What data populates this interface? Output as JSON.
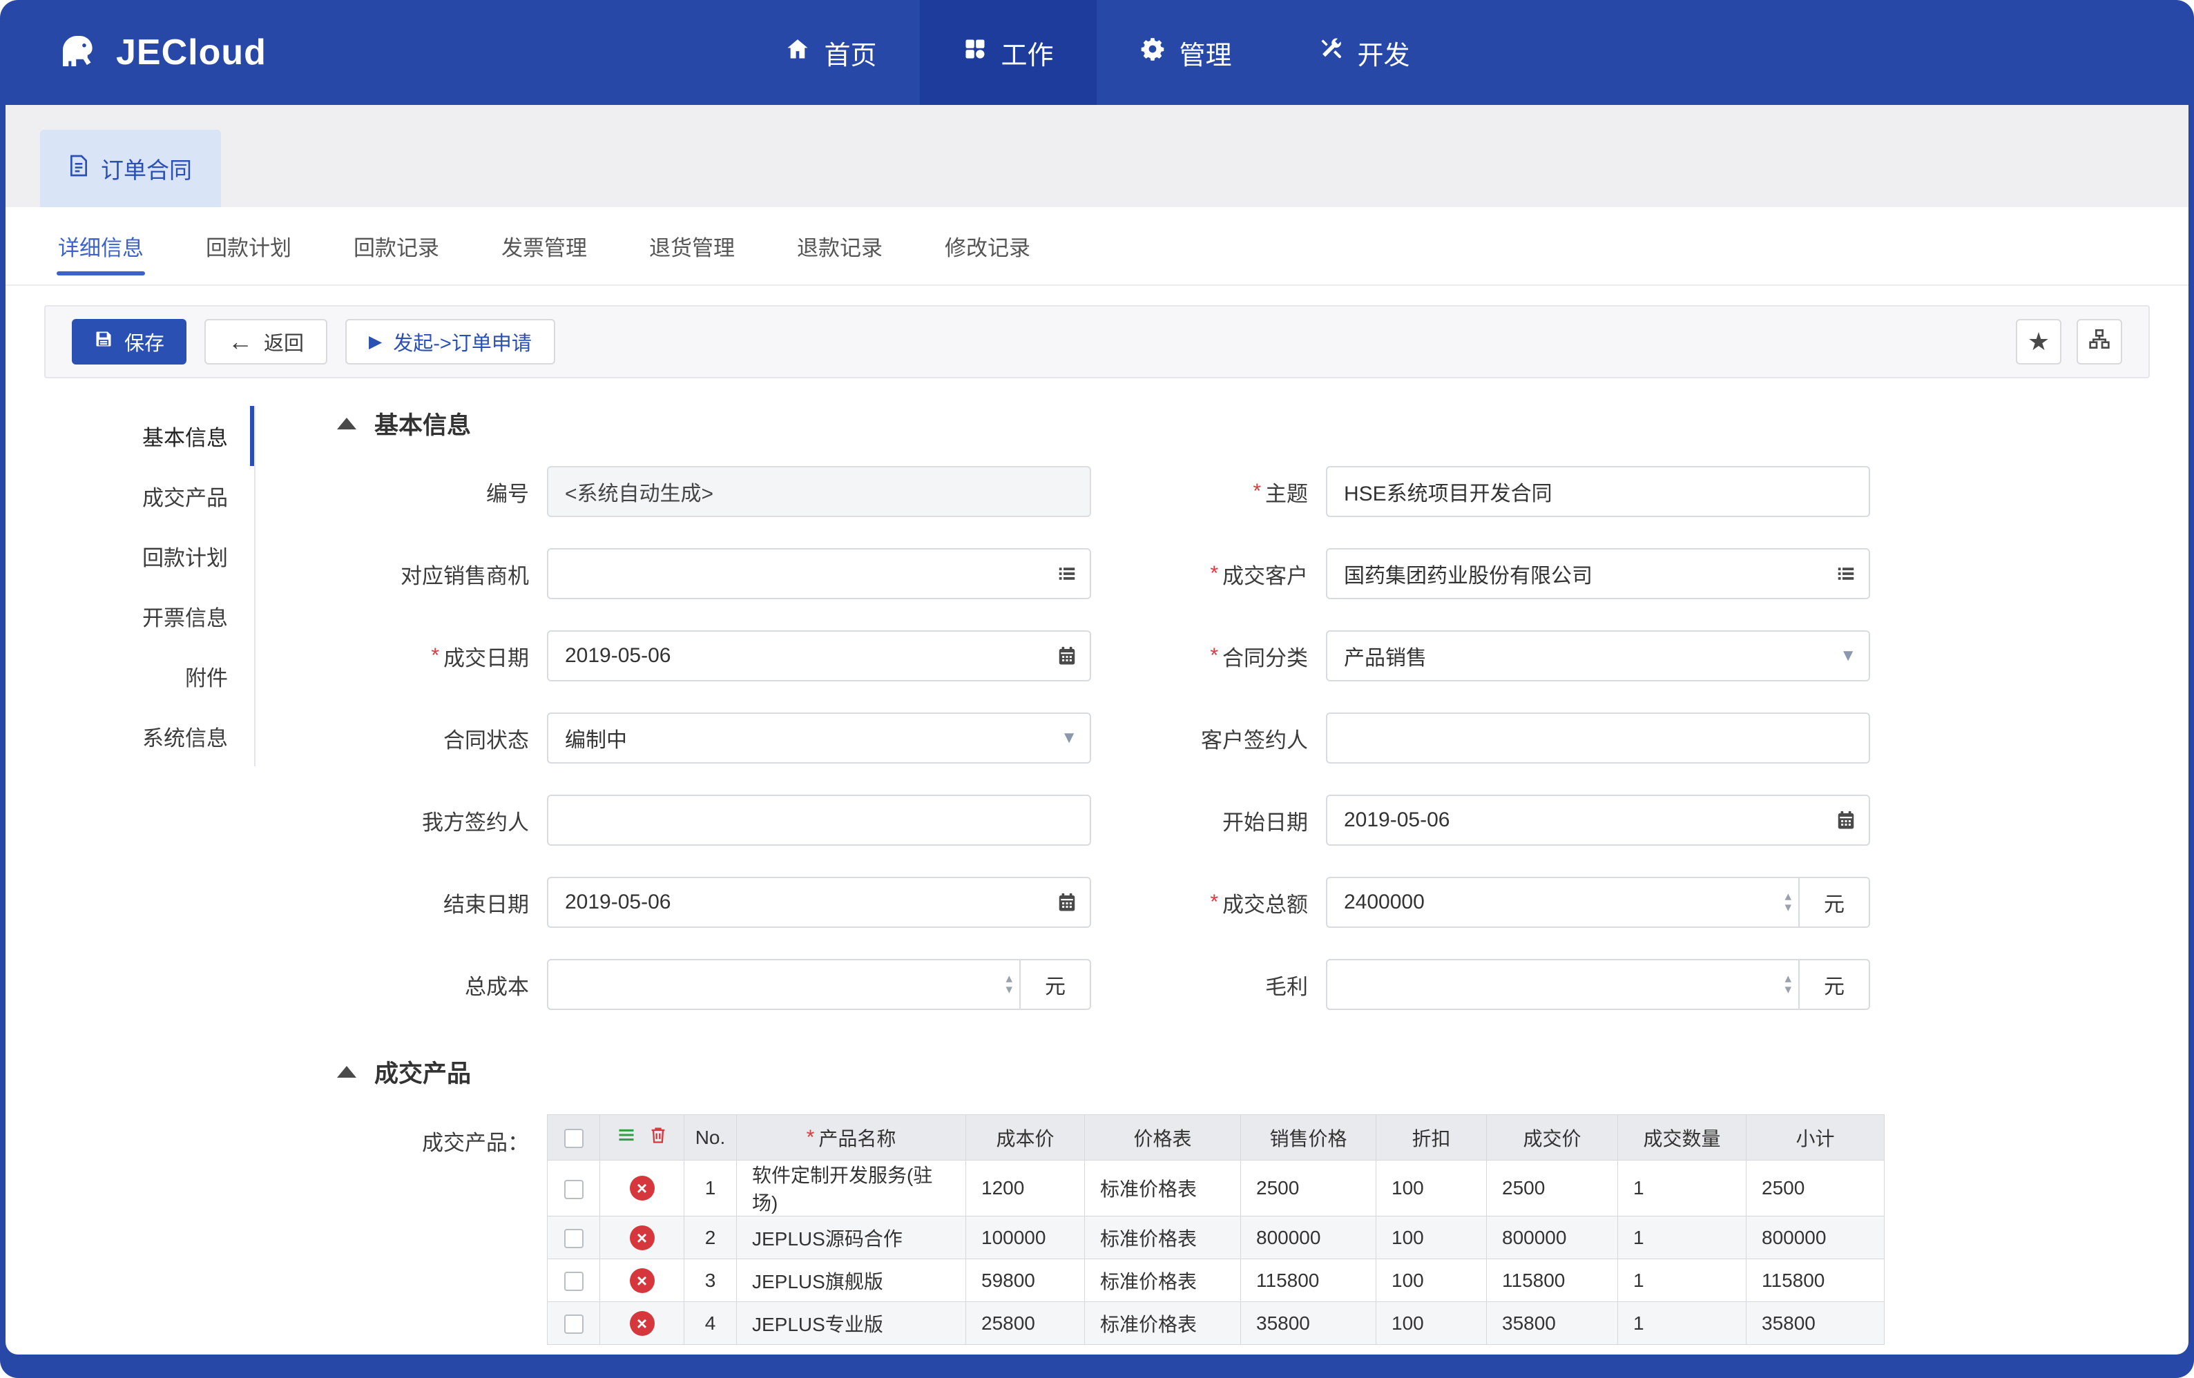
{
  "colors": {
    "primary": "#2848a8",
    "accent": "#2b50b4",
    "subtab_active": "#3a62c8",
    "danger": "#d6373c",
    "green": "#2f9e44",
    "tab_bg": "#d9e4f7"
  },
  "required_mark": "*",
  "icons": {
    "delete_x": "×",
    "star": "★",
    "back_arrow": "←",
    "launch_play": "▶",
    "caret_down": "▼",
    "spin_up": "▴",
    "spin_down": "▾"
  },
  "nav": {
    "brand": "JECloud",
    "items": [
      {
        "label": "首页"
      },
      {
        "label": "工作"
      },
      {
        "label": "管理"
      },
      {
        "label": "开发"
      }
    ]
  },
  "window_tab": {
    "label": "订单合同"
  },
  "subtabs": [
    {
      "label": "详细信息"
    },
    {
      "label": "回款计划"
    },
    {
      "label": "回款记录"
    },
    {
      "label": "发票管理"
    },
    {
      "label": "退货管理"
    },
    {
      "label": "退款记录"
    },
    {
      "label": "修改记录"
    }
  ],
  "toolbar": {
    "save": "保存",
    "back": "返回",
    "launch": "发起->订单申请"
  },
  "anchors": [
    {
      "label": "基本信息"
    },
    {
      "label": "成交产品"
    },
    {
      "label": "回款计划"
    },
    {
      "label": "开票信息"
    },
    {
      "label": "附件"
    },
    {
      "label": "系统信息"
    }
  ],
  "basic": {
    "title": "基本信息",
    "currency_suffix": "元",
    "serial": {
      "label": "编号",
      "value": "<系统自动生成>"
    },
    "subject": {
      "label": "主题",
      "value": "HSE系统项目开发合同"
    },
    "opportunity": {
      "label": "对应销售商机",
      "value": ""
    },
    "customer": {
      "label": "成交客户",
      "value": "国药集团药业股份有限公司"
    },
    "deal_date": {
      "label": "成交日期",
      "value": "2019-05-06"
    },
    "category": {
      "label": "合同分类",
      "value": "产品销售"
    },
    "status": {
      "label": "合同状态",
      "value": "编制中"
    },
    "customer_signer": {
      "label": "客户签约人",
      "value": ""
    },
    "our_signer": {
      "label": "我方签约人",
      "value": ""
    },
    "start_date": {
      "label": "开始日期",
      "value": "2019-05-06"
    },
    "end_date": {
      "label": "结束日期",
      "value": "2019-05-06"
    },
    "total_amount": {
      "label": "成交总额",
      "value": "2400000"
    },
    "total_cost": {
      "label": "总成本",
      "value": ""
    },
    "gross_profit": {
      "label": "毛利",
      "value": ""
    }
  },
  "products": {
    "title": "成交产品",
    "field_label": "成交产品：",
    "headers": {
      "no": "No.",
      "name": "产品名称",
      "cost": "成本价",
      "price_list": "价格表",
      "sale_price": "销售价格",
      "discount": "折扣",
      "deal_price": "成交价",
      "qty": "成交数量",
      "subtotal": "小计"
    },
    "rows": [
      {
        "no": "1",
        "name": "软件定制开发服务(驻场)",
        "cost": "1200",
        "price_list": "标准价格表",
        "sale_price": "2500",
        "discount": "100",
        "deal_price": "2500",
        "qty": "1",
        "subtotal": "2500"
      },
      {
        "no": "2",
        "name": "JEPLUS源码合作",
        "cost": "100000",
        "price_list": "标准价格表",
        "sale_price": "800000",
        "discount": "100",
        "deal_price": "800000",
        "qty": "1",
        "subtotal": "800000"
      },
      {
        "no": "3",
        "name": "JEPLUS旗舰版",
        "cost": "59800",
        "price_list": "标准价格表",
        "sale_price": "115800",
        "discount": "100",
        "deal_price": "115800",
        "qty": "1",
        "subtotal": "115800"
      },
      {
        "no": "4",
        "name": "JEPLUS专业版",
        "cost": "25800",
        "price_list": "标准价格表",
        "sale_price": "35800",
        "discount": "100",
        "deal_price": "35800",
        "qty": "1",
        "subtotal": "35800"
      }
    ]
  }
}
